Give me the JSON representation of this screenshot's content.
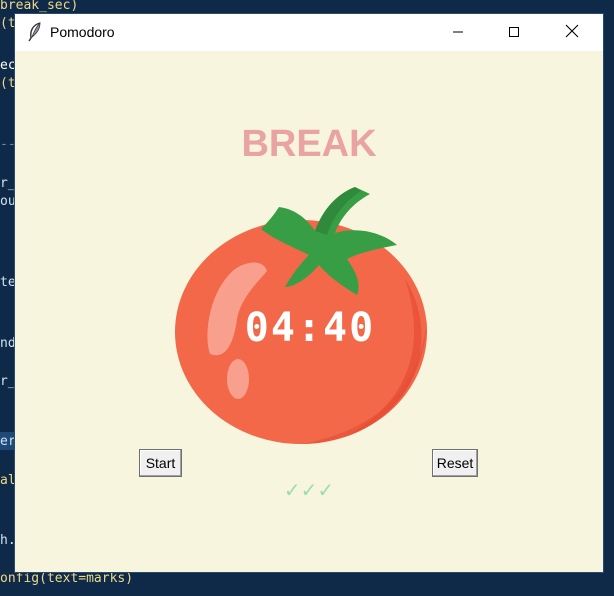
{
  "colors": {
    "editor_bg": "#0f2a48",
    "window_bg": "#f7f5dd",
    "break_label": "#e9a3a3",
    "checkmark": "#9bdeac",
    "tomato_body": "#f26849",
    "tomato_shade": "#e9543b",
    "tomato_leaf": "#389e45"
  },
  "background_code": [
    {
      "text": "break_sec)",
      "color": "#f0d88a"
    },
    {
      "text": "(t",
      "color": "#f0d88a"
    },
    {
      "text": "ec)",
      "color": "#ffffff"
    },
    {
      "text": "(t",
      "color": "#f0d88a"
    },
    {
      "text": "--",
      "color": "#6a8bb0"
    },
    {
      "text": "r_w",
      "color": "#cfe3f5"
    },
    {
      "text": "ou",
      "color": "#cfe3f5"
    },
    {
      "text": "te",
      "color": "#cfe3f5"
    },
    {
      "text": "nd",
      "color": "#cfe3f5"
    },
    {
      "text": "r_",
      "color": "#cfe3f5"
    },
    {
      "text": "er",
      "color": "#cfe3f5"
    },
    {
      "text": "al",
      "color": "#f0d88a"
    },
    {
      "text": "h.",
      "color": "#cfe3f5"
    },
    {
      "text": "onfig(text=marks)",
      "color": "#f0d88a"
    }
  ],
  "window": {
    "title": "Pomodoro",
    "app_icon": "feather-icon",
    "controls": [
      "minimize-icon",
      "maximize-icon",
      "close-icon"
    ]
  },
  "timer": {
    "label": "BREAK",
    "time": "04:40",
    "image": "tomato-icon"
  },
  "buttons": {
    "start_label": "Start",
    "reset_label": "Reset"
  },
  "checkmarks": "✓✓✓"
}
